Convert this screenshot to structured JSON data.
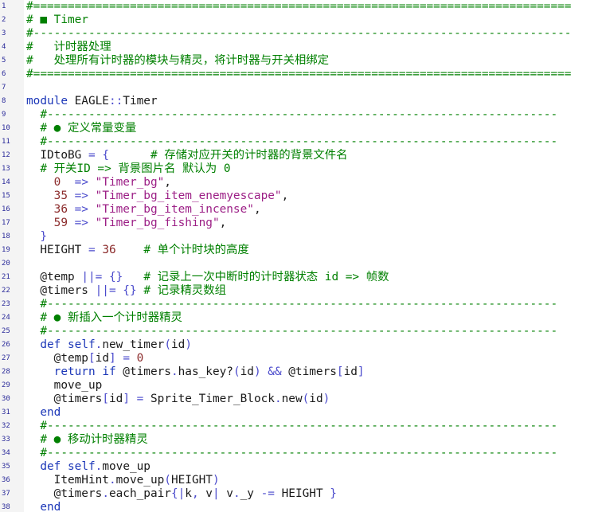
{
  "editor": {
    "lines": [
      {
        "n": "1",
        "tokens": [
          {
            "t": "#==============================================================================",
            "c": "cm"
          }
        ]
      },
      {
        "n": "2",
        "tokens": [
          {
            "t": "# ■ Timer",
            "c": "cm"
          }
        ]
      },
      {
        "n": "3",
        "tokens": [
          {
            "t": "#------------------------------------------------------------------------------",
            "c": "cm"
          }
        ]
      },
      {
        "n": "4",
        "tokens": [
          {
            "t": "#   计时器处理",
            "c": "cm"
          }
        ]
      },
      {
        "n": "5",
        "tokens": [
          {
            "t": "#   处理所有计时器的模块与精灵，将计时器与开关相绑定",
            "c": "cm"
          }
        ]
      },
      {
        "n": "6",
        "tokens": [
          {
            "t": "#==============================================================================",
            "c": "cm"
          }
        ]
      },
      {
        "n": "7",
        "tokens": []
      },
      {
        "n": "8",
        "tokens": [
          {
            "t": "module",
            "c": "kw"
          },
          {
            "t": " EAGLE",
            "c": "sym"
          },
          {
            "t": "::",
            "c": "op"
          },
          {
            "t": "Timer",
            "c": "sym"
          }
        ]
      },
      {
        "n": "9",
        "tokens": [
          {
            "t": "  #--------------------------------------------------------------------------",
            "c": "cm"
          }
        ]
      },
      {
        "n": "10",
        "tokens": [
          {
            "t": "  # ● 定义常量变量",
            "c": "cm"
          }
        ]
      },
      {
        "n": "11",
        "tokens": [
          {
            "t": "  #--------------------------------------------------------------------------",
            "c": "cm"
          }
        ]
      },
      {
        "n": "12",
        "tokens": [
          {
            "t": "  IDtoBG ",
            "c": "sym"
          },
          {
            "t": "=",
            "c": "op"
          },
          {
            "t": " {      ",
            "c": "op"
          },
          {
            "t": "# 存储对应开关的计时器的背景文件名",
            "c": "cm"
          }
        ]
      },
      {
        "n": "13",
        "tokens": [
          {
            "t": "  # 开关ID => 背景图片名 默认为 0",
            "c": "cm"
          }
        ]
      },
      {
        "n": "14",
        "tokens": [
          {
            "t": "    ",
            "c": "sym"
          },
          {
            "t": "0",
            "c": "num"
          },
          {
            "t": "  =>",
            "c": "op"
          },
          {
            "t": " ",
            "c": "sym"
          },
          {
            "t": "\"Timer_bg\"",
            "c": "str"
          },
          {
            "t": ",",
            "c": "sym"
          }
        ]
      },
      {
        "n": "15",
        "tokens": [
          {
            "t": "    ",
            "c": "sym"
          },
          {
            "t": "35",
            "c": "num"
          },
          {
            "t": " =>",
            "c": "op"
          },
          {
            "t": " ",
            "c": "sym"
          },
          {
            "t": "\"Timer_bg_item_enemyescape\"",
            "c": "str"
          },
          {
            "t": ",",
            "c": "sym"
          }
        ]
      },
      {
        "n": "16",
        "tokens": [
          {
            "t": "    ",
            "c": "sym"
          },
          {
            "t": "36",
            "c": "num"
          },
          {
            "t": " =>",
            "c": "op"
          },
          {
            "t": " ",
            "c": "sym"
          },
          {
            "t": "\"Timer_bg_item_incense\"",
            "c": "str"
          },
          {
            "t": ",",
            "c": "sym"
          }
        ]
      },
      {
        "n": "17",
        "tokens": [
          {
            "t": "    ",
            "c": "sym"
          },
          {
            "t": "59",
            "c": "num"
          },
          {
            "t": " =>",
            "c": "op"
          },
          {
            "t": " ",
            "c": "sym"
          },
          {
            "t": "\"Timer_bg_fishing\"",
            "c": "str"
          },
          {
            "t": ",",
            "c": "sym"
          }
        ]
      },
      {
        "n": "18",
        "tokens": [
          {
            "t": "  }",
            "c": "op"
          }
        ]
      },
      {
        "n": "19",
        "tokens": [
          {
            "t": "  HEIGHT ",
            "c": "sym"
          },
          {
            "t": "=",
            "c": "op"
          },
          {
            "t": " ",
            "c": "sym"
          },
          {
            "t": "36",
            "c": "num"
          },
          {
            "t": "    ",
            "c": "sym"
          },
          {
            "t": "# 单个计时块的高度",
            "c": "cm"
          }
        ]
      },
      {
        "n": "20",
        "tokens": []
      },
      {
        "n": "21",
        "tokens": [
          {
            "t": "  @temp ",
            "c": "sym"
          },
          {
            "t": "||=",
            "c": "op"
          },
          {
            "t": " {}",
            "c": "op"
          },
          {
            "t": "   ",
            "c": "sym"
          },
          {
            "t": "# 记录上一次中断时的计时器状态 id => 帧数",
            "c": "cm"
          }
        ]
      },
      {
        "n": "22",
        "tokens": [
          {
            "t": "  @timers ",
            "c": "sym"
          },
          {
            "t": "||=",
            "c": "op"
          },
          {
            "t": " {}",
            "c": "op"
          },
          {
            "t": " ",
            "c": "sym"
          },
          {
            "t": "# 记录精灵数组",
            "c": "cm"
          }
        ]
      },
      {
        "n": "23",
        "tokens": [
          {
            "t": "  #--------------------------------------------------------------------------",
            "c": "cm"
          }
        ]
      },
      {
        "n": "24",
        "tokens": [
          {
            "t": "  # ● 新插入一个计时器精灵",
            "c": "cm"
          }
        ]
      },
      {
        "n": "25",
        "tokens": [
          {
            "t": "  #--------------------------------------------------------------------------",
            "c": "cm"
          }
        ]
      },
      {
        "n": "26",
        "tokens": [
          {
            "t": "  def",
            "c": "kw"
          },
          {
            "t": " ",
            "c": "sym"
          },
          {
            "t": "self",
            "c": "kw"
          },
          {
            "t": ".",
            "c": "op"
          },
          {
            "t": "new_timer",
            "c": "sym"
          },
          {
            "t": "(",
            "c": "op"
          },
          {
            "t": "id",
            "c": "sym"
          },
          {
            "t": ")",
            "c": "op"
          }
        ]
      },
      {
        "n": "27",
        "tokens": [
          {
            "t": "    @temp",
            "c": "sym"
          },
          {
            "t": "[",
            "c": "op"
          },
          {
            "t": "id",
            "c": "sym"
          },
          {
            "t": "]",
            "c": "op"
          },
          {
            "t": " ",
            "c": "sym"
          },
          {
            "t": "=",
            "c": "op"
          },
          {
            "t": " ",
            "c": "sym"
          },
          {
            "t": "0",
            "c": "num"
          }
        ]
      },
      {
        "n": "28",
        "tokens": [
          {
            "t": "    return",
            "c": "kw"
          },
          {
            "t": " ",
            "c": "sym"
          },
          {
            "t": "if",
            "c": "kw"
          },
          {
            "t": " @timers",
            "c": "sym"
          },
          {
            "t": ".",
            "c": "op"
          },
          {
            "t": "has_key?",
            "c": "sym"
          },
          {
            "t": "(",
            "c": "op"
          },
          {
            "t": "id",
            "c": "sym"
          },
          {
            "t": ")",
            "c": "op"
          },
          {
            "t": " ",
            "c": "sym"
          },
          {
            "t": "&&",
            "c": "op"
          },
          {
            "t": " @timers",
            "c": "sym"
          },
          {
            "t": "[",
            "c": "op"
          },
          {
            "t": "id",
            "c": "sym"
          },
          {
            "t": "]",
            "c": "op"
          }
        ]
      },
      {
        "n": "29",
        "tokens": [
          {
            "t": "    move_up",
            "c": "sym"
          }
        ]
      },
      {
        "n": "30",
        "tokens": [
          {
            "t": "    @timers",
            "c": "sym"
          },
          {
            "t": "[",
            "c": "op"
          },
          {
            "t": "id",
            "c": "sym"
          },
          {
            "t": "]",
            "c": "op"
          },
          {
            "t": " ",
            "c": "sym"
          },
          {
            "t": "=",
            "c": "op"
          },
          {
            "t": " Sprite_Timer_Block",
            "c": "sym"
          },
          {
            "t": ".",
            "c": "op"
          },
          {
            "t": "new",
            "c": "sym"
          },
          {
            "t": "(",
            "c": "op"
          },
          {
            "t": "id",
            "c": "sym"
          },
          {
            "t": ")",
            "c": "op"
          }
        ]
      },
      {
        "n": "31",
        "tokens": [
          {
            "t": "  end",
            "c": "kw"
          }
        ]
      },
      {
        "n": "32",
        "tokens": [
          {
            "t": "  #--------------------------------------------------------------------------",
            "c": "cm"
          }
        ]
      },
      {
        "n": "33",
        "tokens": [
          {
            "t": "  # ● 移动计时器精灵",
            "c": "cm"
          }
        ]
      },
      {
        "n": "34",
        "tokens": [
          {
            "t": "  #--------------------------------------------------------------------------",
            "c": "cm"
          }
        ]
      },
      {
        "n": "35",
        "tokens": [
          {
            "t": "  def",
            "c": "kw"
          },
          {
            "t": " ",
            "c": "sym"
          },
          {
            "t": "self",
            "c": "kw"
          },
          {
            "t": ".",
            "c": "op"
          },
          {
            "t": "move_up",
            "c": "sym"
          }
        ]
      },
      {
        "n": "36",
        "tokens": [
          {
            "t": "    ItemHint",
            "c": "sym"
          },
          {
            "t": ".",
            "c": "op"
          },
          {
            "t": "move_up",
            "c": "sym"
          },
          {
            "t": "(",
            "c": "op"
          },
          {
            "t": "HEIGHT",
            "c": "sym"
          },
          {
            "t": ")",
            "c": "op"
          }
        ]
      },
      {
        "n": "37",
        "tokens": [
          {
            "t": "    @timers",
            "c": "sym"
          },
          {
            "t": ".",
            "c": "op"
          },
          {
            "t": "each_pair",
            "c": "sym"
          },
          {
            "t": "{|",
            "c": "op"
          },
          {
            "t": "k",
            "c": "sym"
          },
          {
            "t": ",",
            "c": "op"
          },
          {
            "t": " v",
            "c": "sym"
          },
          {
            "t": "|",
            "c": "op"
          },
          {
            "t": " v",
            "c": "sym"
          },
          {
            "t": ".",
            "c": "op"
          },
          {
            "t": "_y ",
            "c": "sym"
          },
          {
            "t": "-=",
            "c": "op"
          },
          {
            "t": " HEIGHT ",
            "c": "sym"
          },
          {
            "t": "}",
            "c": "op"
          }
        ]
      },
      {
        "n": "38",
        "tokens": [
          {
            "t": "  end",
            "c": "kw"
          }
        ]
      }
    ]
  }
}
